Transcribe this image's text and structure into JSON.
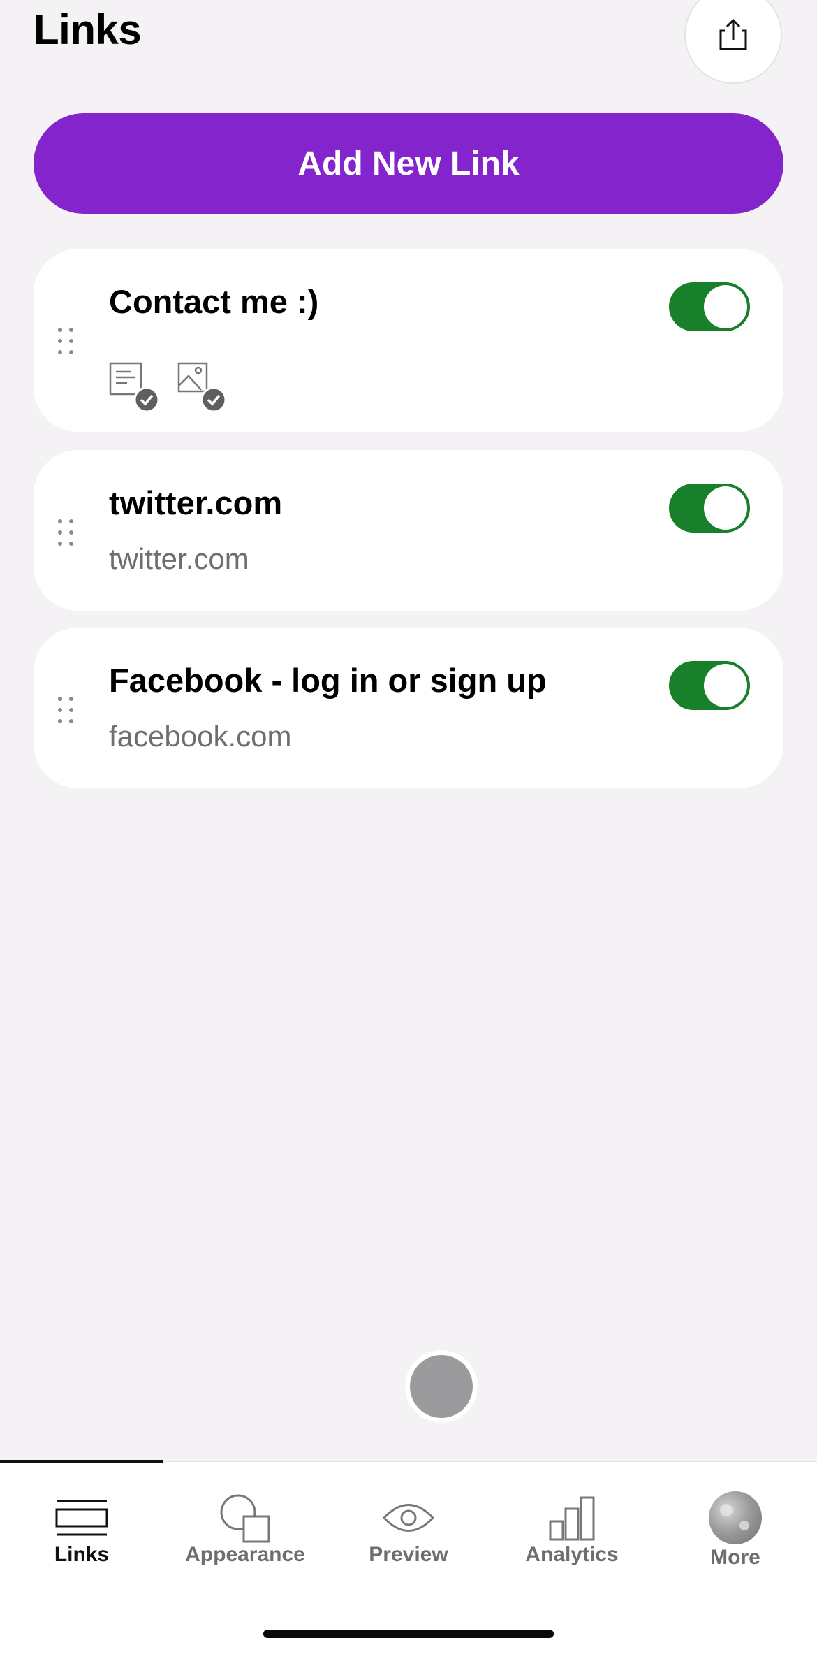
{
  "header": {
    "title": "Links",
    "share_icon": "share-upload-icon"
  },
  "add_button": {
    "label": "Add New Link"
  },
  "links": [
    {
      "title": "Contact me :)",
      "url": "",
      "enabled": true,
      "icons": [
        "form-check-icon",
        "image-check-icon"
      ]
    },
    {
      "title": "twitter.com",
      "url": "twitter.com",
      "enabled": true
    },
    {
      "title": "Facebook - log in or sign up",
      "url": "facebook.com",
      "enabled": true
    }
  ],
  "tabbar": {
    "active": "Links",
    "tabs": [
      {
        "label": "Links",
        "icon": "links-icon"
      },
      {
        "label": "Appearance",
        "icon": "shapes-icon"
      },
      {
        "label": "Preview",
        "icon": "eye-icon"
      },
      {
        "label": "Analytics",
        "icon": "bar-chart-icon"
      },
      {
        "label": "More",
        "icon": "avatar"
      }
    ]
  },
  "colors": {
    "accent": "#8424cc",
    "toggle_on": "#187f2a",
    "background": "#f4f2f4"
  }
}
